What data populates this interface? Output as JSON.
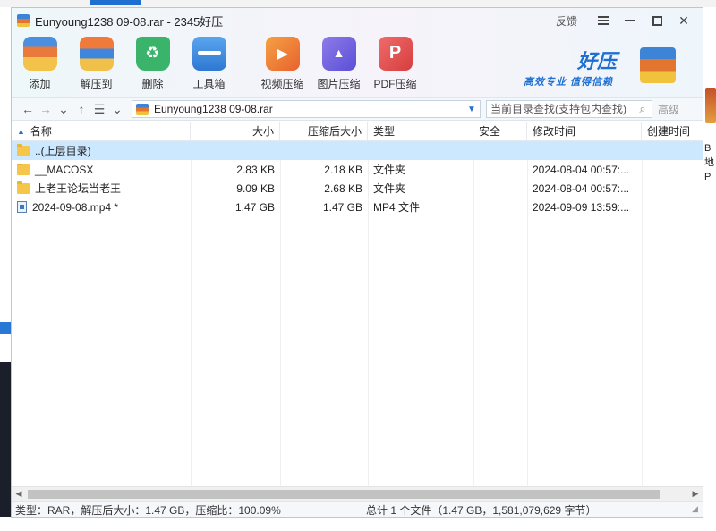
{
  "window": {
    "title": "Eunyoung1238 09-08.rar - 2345好压",
    "feedback_label": "反馈"
  },
  "toolbar": {
    "items": [
      {
        "label": "添加",
        "icon": "add-archive-icon"
      },
      {
        "label": "解压到",
        "icon": "extract-icon"
      },
      {
        "label": "删除",
        "icon": "recycle-delete-icon"
      },
      {
        "label": "工具箱",
        "icon": "toolbox-icon"
      },
      {
        "label": "视频压缩",
        "icon": "video-compress-icon"
      },
      {
        "label": "图片压缩",
        "icon": "image-compress-icon"
      },
      {
        "label": "PDF压缩",
        "icon": "pdf-compress-icon"
      }
    ]
  },
  "brand": {
    "name": "好压",
    "slogan": "高效专业  值得信赖"
  },
  "address": {
    "path": "Eunyoung1238 09-08.rar",
    "search_placeholder": "当前目录查找(支持包内查找)",
    "advanced_label": "高级"
  },
  "columns": {
    "name": "名称",
    "size": "大小",
    "compressed": "压缩后大小",
    "type": "类型",
    "security": "安全",
    "modified": "修改时间",
    "created": "创建时间"
  },
  "rows": [
    {
      "name": "..(上层目录)",
      "size": "",
      "compressed": "",
      "type": "",
      "modified": "",
      "icon": "folder-icon"
    },
    {
      "name": "__MACOSX",
      "size": "2.83 KB",
      "compressed": "2.18 KB",
      "type": "文件夹",
      "modified": "2024-08-04 00:57:...",
      "icon": "folder-icon"
    },
    {
      "name": "上老王论坛当老王",
      "size": "9.09 KB",
      "compressed": "2.68 KB",
      "type": "文件夹",
      "modified": "2024-08-04 00:57:...",
      "icon": "folder-icon"
    },
    {
      "name": "2024-09-08.mp4 *",
      "size": "1.47 GB",
      "compressed": "1.47 GB",
      "type": "MP4 文件",
      "modified": "2024-09-09 13:59:...",
      "icon": "video-file-icon"
    }
  ],
  "status": {
    "left": "类型：RAR，解压后大小：1.47 GB，压缩比：100.09%",
    "right": "总计 1 个文件（1.47 GB，1,581,079,629 字节）"
  },
  "background": {
    "right_text": "B地 P"
  }
}
